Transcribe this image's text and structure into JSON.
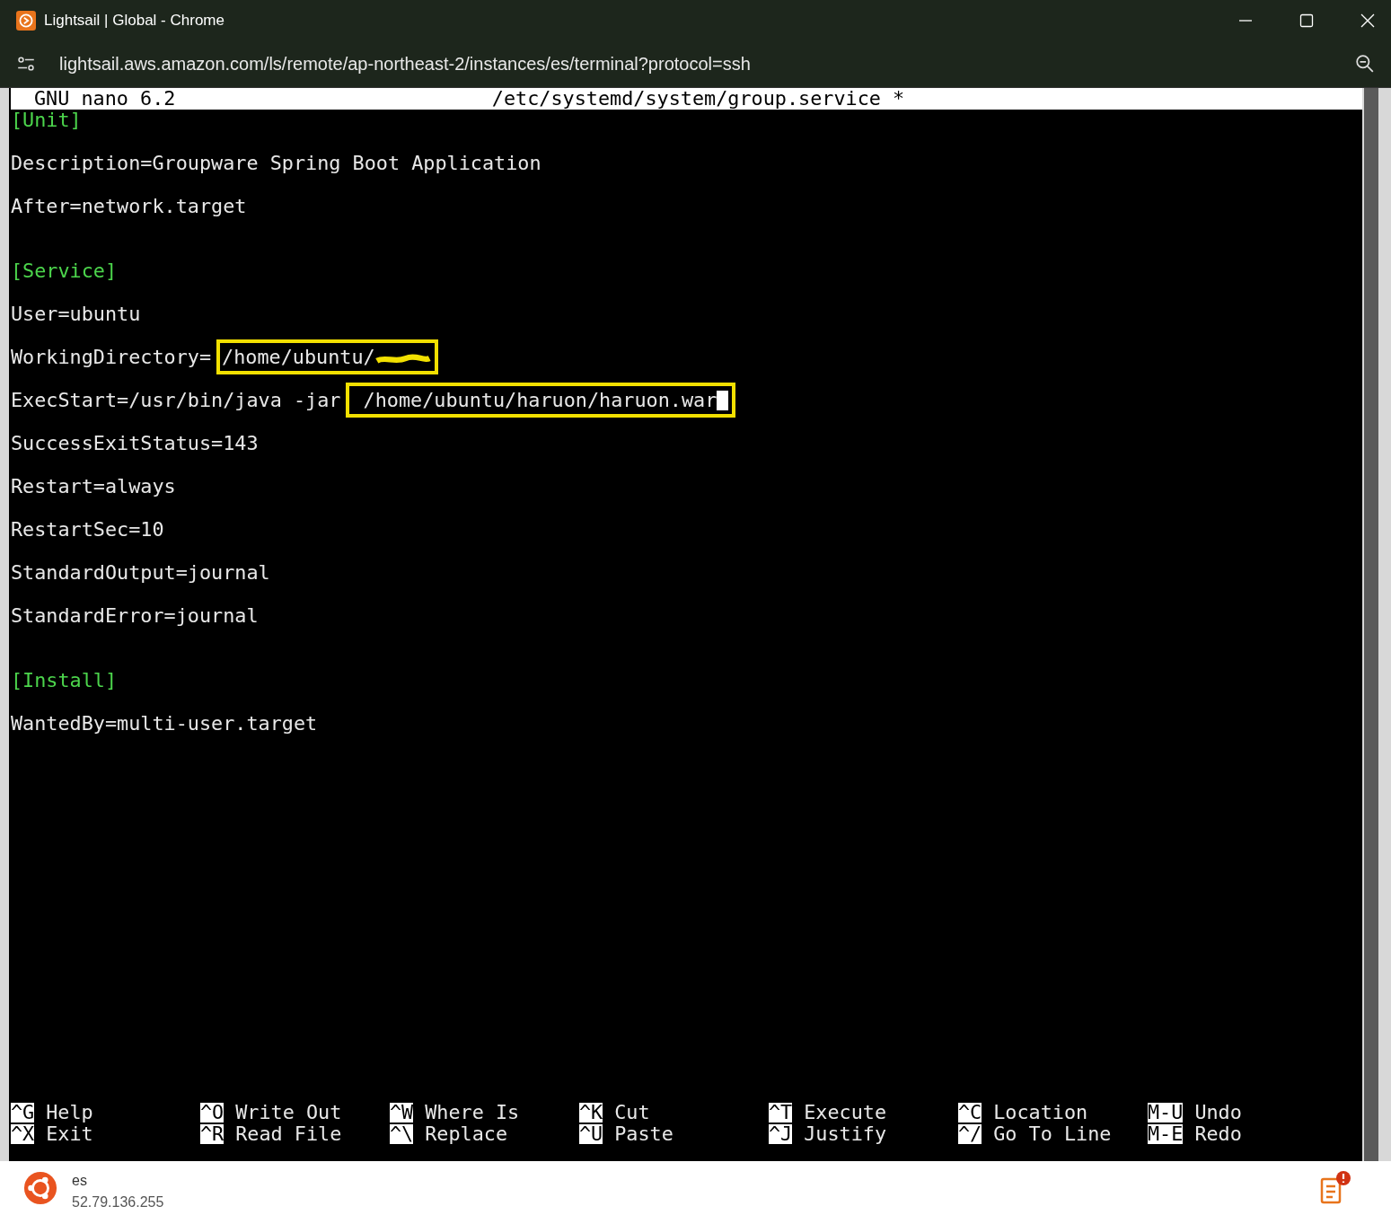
{
  "window": {
    "title": "Lightsail | Global - Chrome"
  },
  "address_bar": {
    "url": "lightsail.aws.amazon.com/ls/remote/ap-northeast-2/instances/es/terminal?protocol=ssh"
  },
  "nano_header": {
    "version": "GNU nano 6.2",
    "filename": "/etc/systemd/system/group.service *"
  },
  "lines": [
    {
      "kind": "section",
      "segments": [
        {
          "text": "[Unit]",
          "boxed": false
        }
      ]
    },
    {
      "kind": "blank"
    },
    {
      "kind": "setting",
      "segments": [
        {
          "text": "Description=Groupware Spring Boot Application",
          "boxed": false
        }
      ]
    },
    {
      "kind": "blank"
    },
    {
      "kind": "setting",
      "segments": [
        {
          "text": "After=network.target",
          "boxed": false
        }
      ]
    },
    {
      "kind": "blank"
    },
    {
      "kind": "blank"
    },
    {
      "kind": "section",
      "segments": [
        {
          "text": "[Service]",
          "boxed": false
        }
      ]
    },
    {
      "kind": "blank"
    },
    {
      "kind": "setting",
      "segments": [
        {
          "text": "User=ubuntu",
          "boxed": false
        }
      ]
    },
    {
      "kind": "blank"
    },
    {
      "kind": "setting",
      "segments": [
        {
          "text": "WorkingDirectory=",
          "boxed": false
        },
        {
          "text": "/home/ubuntu/",
          "boxed": true,
          "redacted": true
        }
      ]
    },
    {
      "kind": "blank"
    },
    {
      "kind": "setting",
      "segments": [
        {
          "text": "ExecStart=/usr/bin/java -jar",
          "boxed": false
        },
        {
          "text": " /home/ubuntu/haruon/haruon.war",
          "boxed": true,
          "cursor": true
        }
      ]
    },
    {
      "kind": "blank"
    },
    {
      "kind": "setting",
      "segments": [
        {
          "text": "SuccessExitStatus=143",
          "boxed": false
        }
      ]
    },
    {
      "kind": "blank"
    },
    {
      "kind": "setting",
      "segments": [
        {
          "text": "Restart=always",
          "boxed": false
        }
      ]
    },
    {
      "kind": "blank"
    },
    {
      "kind": "setting",
      "segments": [
        {
          "text": "RestartSec=10",
          "boxed": false
        }
      ]
    },
    {
      "kind": "blank"
    },
    {
      "kind": "setting",
      "segments": [
        {
          "text": "StandardOutput=journal",
          "boxed": false
        }
      ]
    },
    {
      "kind": "blank"
    },
    {
      "kind": "setting",
      "segments": [
        {
          "text": "StandardError=journal",
          "boxed": false
        }
      ]
    },
    {
      "kind": "blank"
    },
    {
      "kind": "blank"
    },
    {
      "kind": "section",
      "segments": [
        {
          "text": "[Install]",
          "boxed": false
        }
      ]
    },
    {
      "kind": "blank"
    },
    {
      "kind": "setting",
      "segments": [
        {
          "text": "WantedBy=multi-user.target",
          "boxed": false
        }
      ]
    }
  ],
  "shortcuts": [
    {
      "key": "^G",
      "label": "Help"
    },
    {
      "key": "^O",
      "label": "Write Out"
    },
    {
      "key": "^W",
      "label": "Where Is"
    },
    {
      "key": "^K",
      "label": "Cut"
    },
    {
      "key": "^T",
      "label": "Execute"
    },
    {
      "key": "^C",
      "label": "Location"
    },
    {
      "key": "M-U",
      "label": "Undo"
    },
    {
      "key": "^X",
      "label": "Exit"
    },
    {
      "key": "^R",
      "label": "Read File"
    },
    {
      "key": "^\\",
      "label": "Replace"
    },
    {
      "key": "^U",
      "label": "Paste"
    },
    {
      "key": "^J",
      "label": "Justify"
    },
    {
      "key": "^/",
      "label": "Go To Line"
    },
    {
      "key": "M-E",
      "label": "Redo"
    }
  ],
  "instance": {
    "name": "es",
    "ip": "52.79.136.255"
  }
}
